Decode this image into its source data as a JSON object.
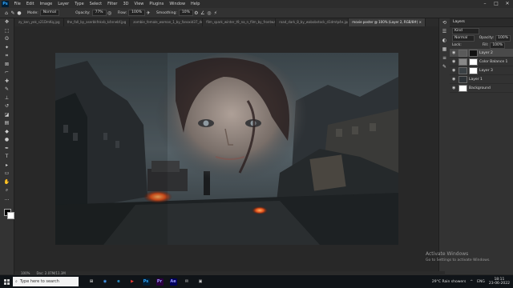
{
  "app": {
    "logo": "Ps"
  },
  "menu": [
    "File",
    "Edit",
    "Image",
    "Layer",
    "Type",
    "Select",
    "Filter",
    "3D",
    "View",
    "Plugins",
    "Window",
    "Help"
  ],
  "window_controls": [
    "–",
    "□",
    "✕"
  ],
  "options_bar": {
    "mode_label": "Mode:",
    "mode_value": "Normal",
    "opacity_label": "Opacity:",
    "opacity_value": "77%",
    "flow_label": "Flow:",
    "flow_value": "100%",
    "smoothing_label": "Smoothing:",
    "smoothing_value": "10%"
  },
  "tabs": [
    {
      "label": "zy_ken_yek_s21DmKq.jpg"
    },
    {
      "label": "the_fall_by_aserbkfnkvb_k4nnebf.jpg"
    },
    {
      "label": "zombie_female_woman_1_by_fanoxid37_de8kpd.jpg"
    },
    {
      "label": "film_spark_winter_t9_na_n_film_by_frontwarm_d4bxmk.jpg"
    },
    {
      "label": "road_dark_8_by_wabobstock_d1dmtp4e.jpg"
    },
    {
      "label": "movie poster @ 100% (Layer 2, RGB/8#) ×",
      "active": true
    }
  ],
  "layers_panel": {
    "title": "Layers",
    "filter": "Kind",
    "blend_mode": "Normal",
    "opacity_label": "Opacity:",
    "opacity": "100%",
    "lock_label": "Lock:",
    "fill_label": "Fill:",
    "fill": "100%",
    "layers": [
      {
        "name": "Layer 2",
        "selected": true
      },
      {
        "name": "Color Balance 1"
      },
      {
        "name": "Layer 3"
      },
      {
        "name": "Layer 1"
      },
      {
        "name": "Background"
      }
    ]
  },
  "status": {
    "zoom": "100%",
    "doc": "Doc: 2.07M/11.3M"
  },
  "watermark": {
    "line1": "Activate Windows",
    "line2": "Go to Settings to activate Windows."
  },
  "taskbar": {
    "search_placeholder": "Type here to search",
    "apps": [
      "⊞",
      "◉",
      "e",
      "▶",
      "Ps",
      "Pr",
      "Ae",
      "✉",
      "▣"
    ],
    "weather": "29°C  Rain showers",
    "lang": "ENG",
    "time": "18:11",
    "date": "23-06-2022"
  },
  "colors": {
    "accent": "#31a8ff",
    "panel": "#323232",
    "canvas_bg": "#282828"
  }
}
